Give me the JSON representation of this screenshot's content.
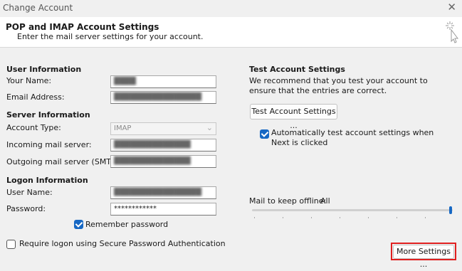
{
  "window": {
    "title": "Change Account"
  },
  "header": {
    "title": "POP and IMAP Account Settings",
    "subtitle": "Enter the mail server settings for your account."
  },
  "user_info": {
    "heading": "User Information",
    "name_label": "Your Name:",
    "name_value": "████",
    "email_label": "Email Address:",
    "email_value": "████████████████"
  },
  "server_info": {
    "heading": "Server Information",
    "account_type_label": "Account Type:",
    "account_type_value": "IMAP",
    "incoming_label": "Incoming mail server:",
    "incoming_value": "██████████████",
    "outgoing_label": "Outgoing mail server (SMTP):",
    "outgoing_value": "██████████████"
  },
  "logon_info": {
    "heading": "Logon Information",
    "user_label": "User Name:",
    "user_value": "████████████████",
    "password_label": "Password:",
    "password_value": "************",
    "remember_label": "Remember password",
    "remember_checked": true,
    "spa_label": "Require logon using Secure Password Authentication",
    "spa_checked": false
  },
  "test": {
    "heading": "Test Account Settings",
    "description": "We recommend that you test your account to ensure that the entries are correct.",
    "button_label": "Test Account Settings ...",
    "auto_label": "Automatically test account settings when Next is clicked",
    "auto_checked": true
  },
  "offline": {
    "label": "Mail to keep offline:",
    "value": "All",
    "slider_level": 1.0
  },
  "more_settings_label": "More Settings ...",
  "colors": {
    "accent": "#1668c4",
    "highlight": "#e02020"
  }
}
